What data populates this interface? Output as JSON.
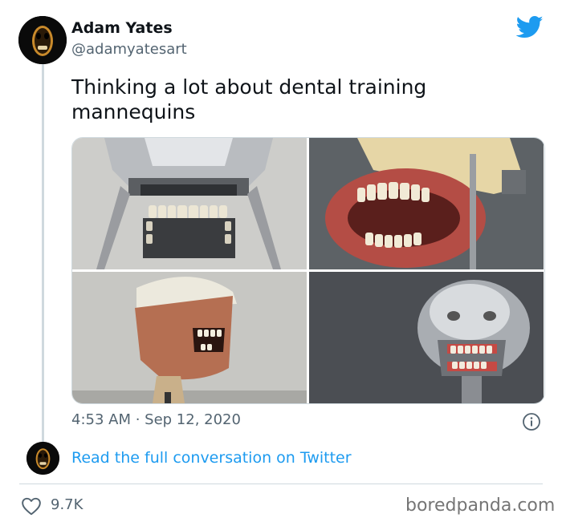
{
  "author": {
    "name": "Adam Yates",
    "handle": "@adamyatesart",
    "avatar_icon": "dark-mask-avatar"
  },
  "tweet": {
    "text": "Thinking a lot about dental training mannequins",
    "timestamp": "4:53 AM · Sep 12, 2020",
    "photos": [
      "metal-mannequin-jaw-photo",
      "red-gum-denture-model-photo",
      "rubber-face-mannequin-photo",
      "chrome-head-mannequin-photo"
    ]
  },
  "footer": {
    "read_link": "Read the full conversation on Twitter",
    "likes": "9.7K"
  },
  "watermark": "boredpanda.com",
  "colors": {
    "link": "#1d9bf0",
    "muted": "#536471",
    "twitter_blue": "#1d9bf0"
  }
}
